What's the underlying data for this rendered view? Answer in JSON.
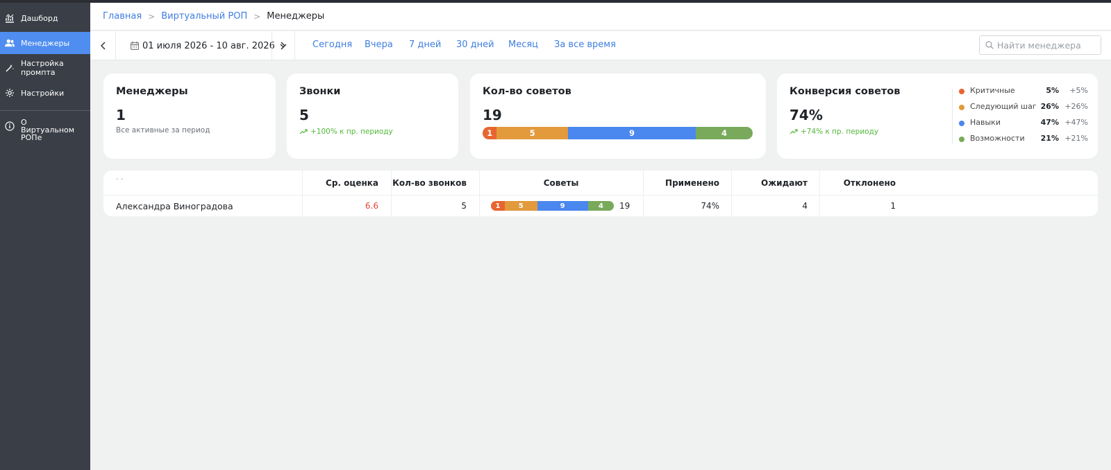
{
  "sidebar": {
    "items": [
      {
        "label": "Дашборд",
        "icon": "chart-icon"
      },
      {
        "label": "Менеджеры",
        "icon": "users-icon",
        "active": true
      },
      {
        "label": "Настройка промпта",
        "icon": "magic-wand-icon"
      },
      {
        "label": "Настройки",
        "icon": "gear-icon"
      },
      {
        "label": "О Виртуальном РОПе",
        "icon": "info-icon"
      }
    ]
  },
  "breadcrumb": {
    "items": [
      "Главная",
      "Виртуальный РОП"
    ],
    "current": "Менеджеры"
  },
  "toolbar": {
    "date_range": "01 июля 2026 - 10 авг. 2026",
    "periods": [
      "Сегодня",
      "Вчера",
      "7 дней",
      "30 дней",
      "Месяц",
      "За все время"
    ],
    "search_placeholder": "Найти менеджера"
  },
  "cards": {
    "managers": {
      "title": "Менеджеры",
      "value": "1",
      "sub": "Все активные за период"
    },
    "calls": {
      "title": "Звонки",
      "value": "5",
      "trend": "+100% к пр. периоду"
    },
    "tips": {
      "title": "Кол-во советов",
      "value": "19",
      "segments": [
        1,
        5,
        9,
        4
      ]
    },
    "conversion": {
      "title": "Конверсия советов",
      "value": "74%",
      "trend": "+74% к пр. периоду",
      "legend": [
        {
          "name": "Критичные",
          "pct": "5%",
          "delta": "+5%",
          "color": "#e8652f"
        },
        {
          "name": "Следующий шаг",
          "pct": "26%",
          "delta": "+26%",
          "color": "#e29a3c"
        },
        {
          "name": "Навыки",
          "pct": "47%",
          "delta": "+47%",
          "color": "#4a87ee"
        },
        {
          "name": "Возможности",
          "pct": "21%",
          "delta": "+21%",
          "color": "#79aa5b"
        }
      ]
    }
  },
  "colors": {
    "critical": "#e8652f",
    "next_step": "#e29a3c",
    "skills": "#4a87ee",
    "opportunities": "#79aa5b",
    "accent": "#4f8ef0",
    "score_low": "#e0453a"
  },
  "table": {
    "headers": {
      "name": "- -",
      "score": "Ср. оценка",
      "calls": "Кол-во звонков",
      "tips": "Советы",
      "applied": "Применено",
      "pending": "Ожидают",
      "rejected": "Отклонено"
    },
    "rows": [
      {
        "name": "Александра Виноградова",
        "score": "6.6",
        "calls": "5",
        "tips_segments": [
          1,
          5,
          9,
          4
        ],
        "tips_total": "19",
        "applied": "74%",
        "pending": "4",
        "rejected": "1"
      }
    ]
  }
}
